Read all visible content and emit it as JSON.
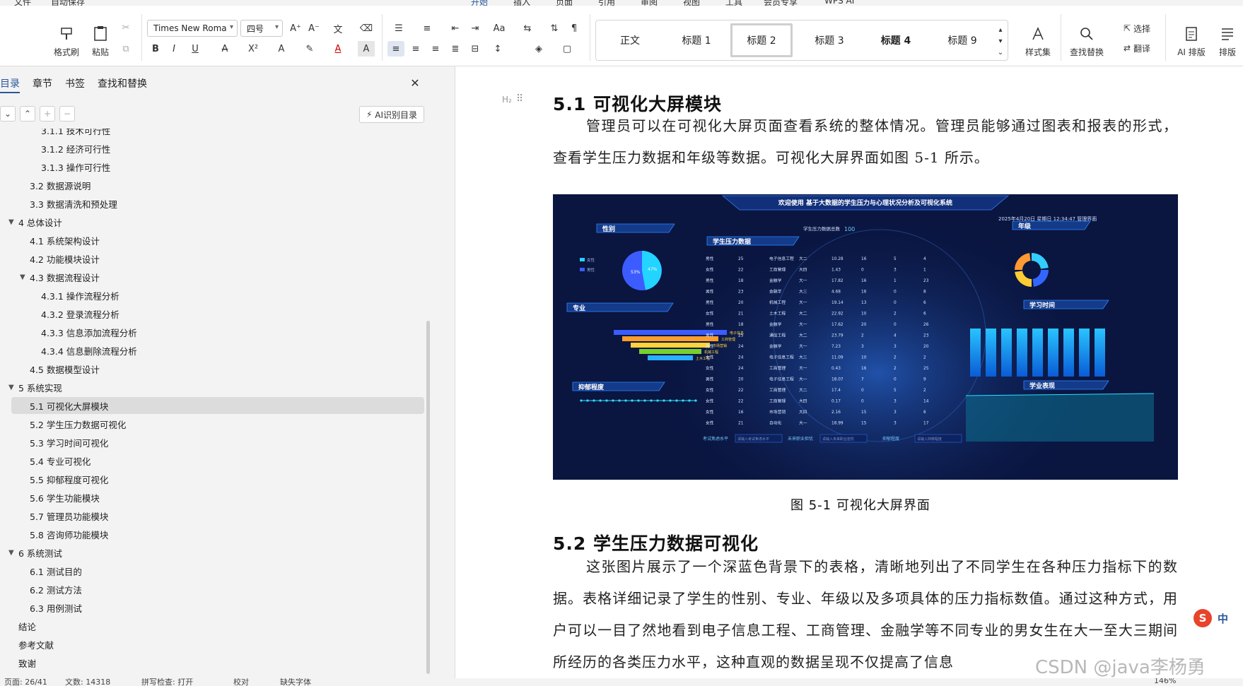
{
  "menubar": {
    "items": [
      {
        "label": "文件"
      },
      {
        "label": "自动保存"
      },
      {
        "label": "开始"
      },
      {
        "label": "插入"
      },
      {
        "label": "页面"
      },
      {
        "label": "引用"
      },
      {
        "label": "审阅"
      },
      {
        "label": "视图"
      },
      {
        "label": "工具"
      },
      {
        "label": "会员专享"
      },
      {
        "label": "WPS AI"
      }
    ],
    "active": "开始"
  },
  "ribbon": {
    "clipboard": {
      "format_painter": "格式刷",
      "paste": "粘贴"
    },
    "font_name": "Times New Roma",
    "font_size": "四号",
    "styles": [
      "正文",
      "标题 1",
      "标题 2",
      "标题 3",
      "标题 4",
      "标题 9"
    ],
    "style_selected": "标题 2",
    "style_set": "样式集",
    "find_replace": "查找替换",
    "select": "选择",
    "translate": "翻译",
    "ai_layout": "AI 排版",
    "layout": "排版"
  },
  "nav_panel": {
    "tabs": [
      "目录",
      "章节",
      "书签",
      "查找和替换"
    ],
    "active_tab": "目录",
    "ai_toc": "AI识别目录",
    "toc": [
      {
        "text": "3.1.1 技术可行性",
        "level": 3
      },
      {
        "text": "3.1.2 经济可行性",
        "level": 3
      },
      {
        "text": "3.1.3 操作可行性",
        "level": 3
      },
      {
        "text": "3.2 数据源说明",
        "level": 2
      },
      {
        "text": "3.3 数据清洗和预处理",
        "level": 2
      },
      {
        "text": "4 总体设计",
        "level": 1,
        "expanded": true
      },
      {
        "text": "4.1 系统架构设计",
        "level": 2
      },
      {
        "text": "4.2 功能模块设计",
        "level": 2
      },
      {
        "text": "4.3 数据流程设计",
        "level": 2,
        "expanded": true
      },
      {
        "text": "4.3.1 操作流程分析",
        "level": 3
      },
      {
        "text": "4.3.2 登录流程分析",
        "level": 3
      },
      {
        "text": "4.3.3 信息添加流程分析",
        "level": 3
      },
      {
        "text": "4.3.4 信息删除流程分析",
        "level": 3
      },
      {
        "text": "4.5  数据模型设计",
        "level": 2
      },
      {
        "text": "5 系统实现",
        "level": 1,
        "expanded": true
      },
      {
        "text": "5.1  可视化大屏模块",
        "level": 2,
        "selected": true
      },
      {
        "text": "5.2  学生压力数据可视化",
        "level": 2
      },
      {
        "text": "5.3  学习时间可视化",
        "level": 2
      },
      {
        "text": "5.4  专业可视化",
        "level": 2
      },
      {
        "text": "5.5  抑郁程度可视化",
        "level": 2
      },
      {
        "text": "5.6  学生功能模块",
        "level": 2
      },
      {
        "text": "5.7  管理员功能模块",
        "level": 2
      },
      {
        "text": "5.8  咨询师功能模块",
        "level": 2
      },
      {
        "text": "6 系统测试",
        "level": 1,
        "expanded": true
      },
      {
        "text": "6.1  测试目的",
        "level": 2
      },
      {
        "text": "6.2  测试方法",
        "level": 2
      },
      {
        "text": "6.3  用例测试",
        "level": 2
      },
      {
        "text": "结论",
        "level": 1
      },
      {
        "text": "参考文献",
        "level": 1
      },
      {
        "text": "致谢",
        "level": 1
      }
    ]
  },
  "document": {
    "heading_marker": "H₂",
    "section_51": "5.1  可视化大屏模块",
    "para_51": "管理员可以在可视化大屏页面查看系统的整体情况。管理员能够通过图表和报表的形式，查看学生压力数据和年级等数据。可视化大屏界面如图 5-1 所示。",
    "caption": "图 5-1  可视化大屏界面",
    "section_52": "5.2  学生压力数据可视化",
    "para_52": "这张图片展示了一个深蓝色背景下的表格，清晰地列出了不同学生在各种压力指标下的数据。表格详细记录了学生的性别、专业、年级以及多项具体的压力指标数值。通过这种方式，用户可以一目了然地看到电子信息工程、工商管理、金融学等不同专业的男女生在大一至大三期间所经历的各类压力水平，这种直观的数据呈现不仅提高了信息"
  },
  "dashboard": {
    "title": "欢迎使用 基于大数据的学生压力与心理状况分析及可视化系统",
    "datetime": "2025年4月20日 星期日 12:34:47  管理界面",
    "panels": {
      "gender": "性别",
      "major": "专业",
      "depression": "抑郁程度",
      "stress_data": "学生压力数据",
      "stress_total_label": "学生压力数据总数",
      "stress_total": "100",
      "grade": "年级",
      "study_time": "学习时间",
      "performance": "学业表现"
    },
    "gender_legend": [
      "女性",
      "男性"
    ],
    "gender_pct": [
      "53%",
      "47%"
    ],
    "funnel_labels": [
      "电子信息",
      "工商管理",
      "市场营销",
      "机械工程",
      "土木工程"
    ],
    "bottom_fields": [
      {
        "label": "考试焦虑水平",
        "placeholder": "请输入考试焦虑水平"
      },
      {
        "label": "未来职业担忧",
        "placeholder": "请输入未来职业担忧"
      },
      {
        "label": "抑郁程度",
        "placeholder": "请输入抑郁程度"
      }
    ],
    "table_rows": [
      [
        "男性",
        "25",
        "电子信息工程",
        "大二",
        "10.28",
        "16",
        "5",
        "4"
      ],
      [
        "女性",
        "22",
        "工商管理",
        "大四",
        "1.43",
        "0",
        "3",
        "1"
      ],
      [
        "男性",
        "18",
        "金融学",
        "大一",
        "17.82",
        "16",
        "1",
        "23"
      ],
      [
        "男性",
        "23",
        "金融学",
        "大三",
        "4.68",
        "16",
        "0",
        "8"
      ],
      [
        "男性",
        "20",
        "机械工程",
        "大一",
        "19.14",
        "13",
        "0",
        "6"
      ],
      [
        "女性",
        "21",
        "土木工程",
        "大二",
        "22.92",
        "10",
        "2",
        "6"
      ],
      [
        "男性",
        "18",
        "金融学",
        "大一",
        "17.62",
        "20",
        "0",
        "26"
      ],
      [
        "男性",
        "25",
        "通信工程",
        "大二",
        "23.79",
        "2",
        "4",
        "23"
      ],
      [
        "男性",
        "24",
        "金融学",
        "大一",
        "7.23",
        "3",
        "3",
        "20"
      ],
      [
        "女性",
        "24",
        "电子信息工程",
        "大三",
        "11.09",
        "10",
        "2",
        "2"
      ],
      [
        "女性",
        "24",
        "工商管理",
        "大一",
        "0.43",
        "16",
        "2",
        "25"
      ],
      [
        "男性",
        "20",
        "电子信息工程",
        "大一",
        "18.07",
        "7",
        "0",
        "9"
      ],
      [
        "女性",
        "22",
        "工商管理",
        "大二",
        "17.4",
        "0",
        "5",
        "2"
      ],
      [
        "女性",
        "22",
        "工商管理",
        "大四",
        "0.17",
        "0",
        "3",
        "14"
      ],
      [
        "女性",
        "16",
        "市场营销",
        "大四",
        "2.16",
        "15",
        "3",
        "6"
      ],
      [
        "女性",
        "21",
        "自动化",
        "大一",
        "18.99",
        "15",
        "3",
        "17"
      ]
    ],
    "study_bars": [
      0.85,
      0.85,
      0.85,
      0.85,
      0.85,
      0.85,
      0.85,
      0.85,
      0.85
    ],
    "colors": {
      "bg": "#0a1540",
      "accent": "#1ea0ff",
      "donut": [
        "#33ccff",
        "#3366ff",
        "#ffcc33",
        "#ff9933"
      ]
    }
  },
  "statusbar": {
    "page": "页面: 26/41",
    "words": "文数: 14318",
    "spell": "拼写检查: 打开",
    "proof": "校对",
    "font_missing": "缺失字体",
    "zoom": "146%"
  },
  "watermark": "CSDN @java李杨勇",
  "ime": {
    "label": "中"
  }
}
